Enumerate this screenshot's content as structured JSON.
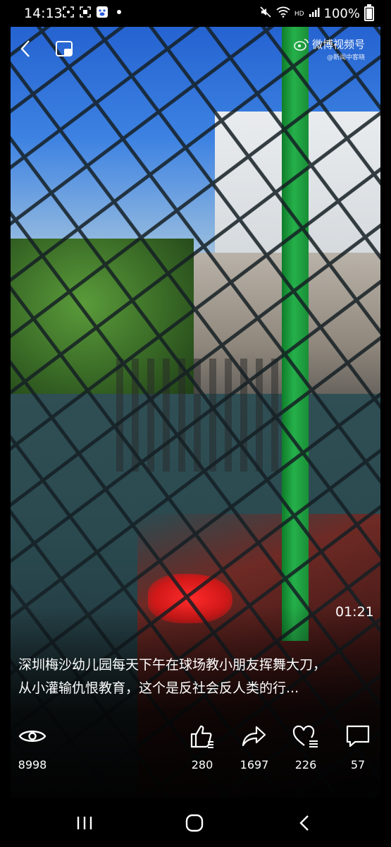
{
  "status_bar": {
    "time": "14:13",
    "network": "HD",
    "battery": "100%"
  },
  "watermark": {
    "title": "微博视频号",
    "subtitle": "@新闻中客晓"
  },
  "video": {
    "duration": "01:21"
  },
  "caption": {
    "line1": "深圳梅沙幼儿园每天下午在球场教小朋友挥舞大刀，",
    "line2": "从小灌输仇恨教育，这个是反社会反人类的行..."
  },
  "actions": {
    "views": "8998",
    "likes": "280",
    "shares": "1697",
    "favorites": "226",
    "comments": "57"
  },
  "colors": {
    "pole_green": "#25b04a",
    "accent_red": "#ff2a2a"
  }
}
